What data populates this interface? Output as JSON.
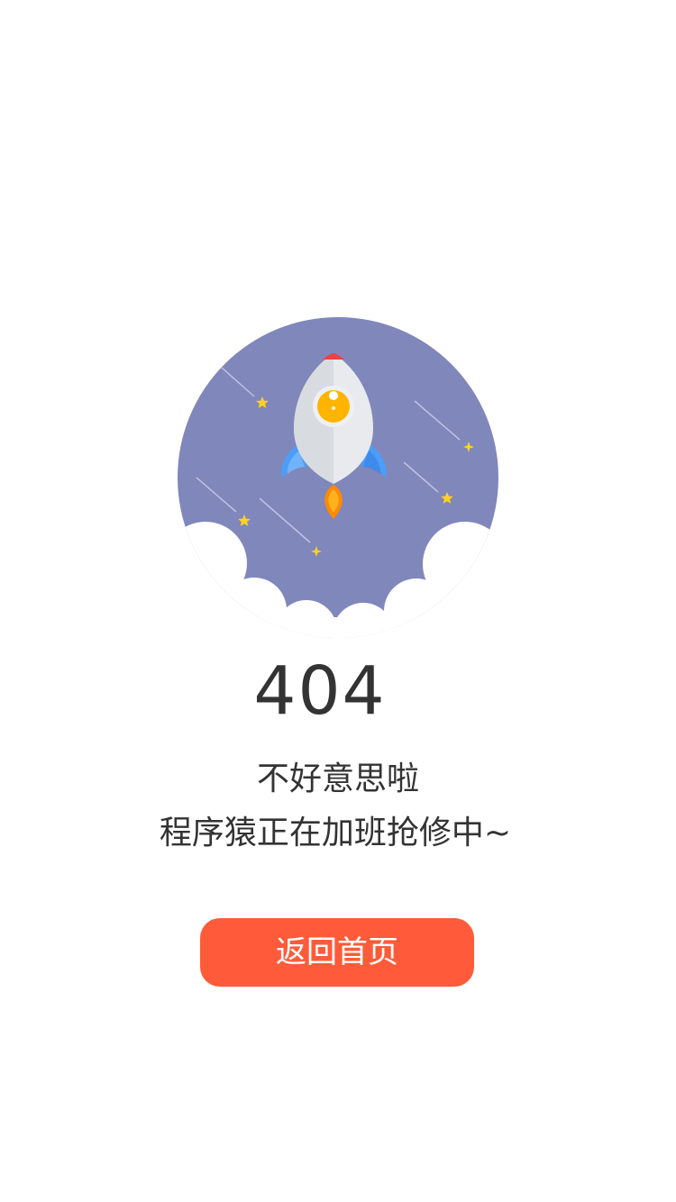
{
  "error": {
    "code": "404"
  },
  "message": {
    "line1": "不好意思啦",
    "line2": "程序猿正在加班抢修中~"
  },
  "actions": {
    "home_label": "返回首页"
  },
  "illustration": {
    "icon": "rocket-icon",
    "colors": {
      "sky": "#8087bb",
      "cloud": "#ffffff",
      "rocket_body": "#e8eaee",
      "rocket_shadow": "#d6d9de",
      "rocket_nose": "#f23f3f",
      "window": "#ffb400",
      "fins": "#4b9df7",
      "flame": "#ff8a00",
      "stars": "#ffd21f"
    }
  },
  "theme": {
    "button_color": "#ff5b3a",
    "text_color": "#333333",
    "background": "#ffffff"
  }
}
